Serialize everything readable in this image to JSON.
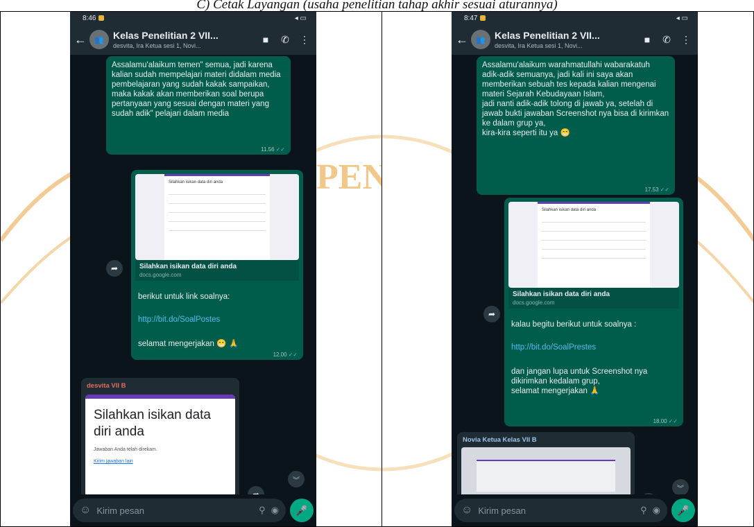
{
  "caption": "C) Cetak Layangan (usaha penelitian tahap akhir sesuai aturannya)",
  "left": {
    "status_time": "8:46",
    "status_right": "◂ ▭",
    "chat_title": "Kelas Penelitian 2 VII...",
    "chat_subtitle": "desvita, Ira Ketua sesi 1, Novi...",
    "msg1": {
      "text": "Assalamu'alaikum temen\" semua, jadi karena kalian sudah mempelajari materi didalam media pembelajaran yang sudah kakak sampaikan, maka kakak akan memberikan soal berupa pertanyaan yang sesuai dengan materi yang sudah adik\" pelajari dalam media",
      "time": "11.56"
    },
    "msg2": {
      "form_heading": "Silahkan isikan data diri anda",
      "link_title": "Silahkan isikan data diri anda",
      "link_domain": "docs.google.com",
      "text1": "berikut untuk link soalnya:",
      "link": "http://bit.do/SoalPostes",
      "text2": "selamat mengerjakan 😁 🙏",
      "time": "12.00"
    },
    "msg3": {
      "sender": "desvita VII B",
      "form_title": "Silahkan isikan data diri anda",
      "form_note": "Jawaban Anda telah direkam.",
      "form_link": "Kirim jawaban lain"
    },
    "composer_placeholder": "Kirim pesan"
  },
  "right": {
    "status_time": "8:47",
    "status_right": "◂ ▭",
    "chat_title": "Kelas Penelitian 2 VII...",
    "chat_subtitle": "desvita, Ira Ketua sesi 1, Novi...",
    "msg1": {
      "text": "Assalamu'alaikum warahmatullahi wabarakatuh adik-adik semuanya, jadi kali ini saya akan memberikan sebuah tes kepada kalian mengenai materi Sejarah Kebudayaan Islam,\njadi nanti adik-adik tolong di jawab ya, setelah di jawab bukti jawaban Screenshot nya bisa di kirimkan ke dalam grup ya,\nkira-kira seperti itu ya 😁",
      "time": "17.53"
    },
    "msg2": {
      "form_heading": "Silahkan isikan data diri anda",
      "link_title": "Silahkan isikan data diri anda",
      "link_domain": "docs.google.com",
      "text1": "kalau begitu berikut untuk soalnya :",
      "link": "http://bit.do/SoalPrestes",
      "text2": "dan jangan lupa untuk Screenshot nya dikirimkan kedalam grup,\nselamat mengerjakan 🙏",
      "time": "18.00"
    },
    "msg3": {
      "sender": "Novia Ketua Kelas VII B"
    },
    "composer_placeholder": "Kirim pesan"
  },
  "watermark_text": "PENDIDI",
  "colors": {
    "chat_bg": "#0b141a",
    "header_bg": "#1f2c34",
    "outgoing_bubble": "#005c4b",
    "incoming_bubble": "#1f2c34",
    "link": "#53bdeb",
    "send_button": "#00a884",
    "watermark": "#e8a33d",
    "sender_left": "#e26b5c",
    "sender_right": "#9fc5e8"
  }
}
